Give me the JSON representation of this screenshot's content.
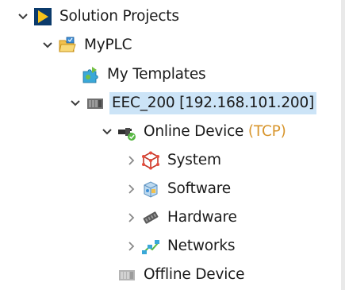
{
  "tree": {
    "solution": {
      "label": "Solution Projects",
      "expanded": true,
      "icon": "solution-logo-icon"
    },
    "plc": {
      "label": "MyPLC",
      "expanded": true,
      "icon": "project-folder-icon"
    },
    "templates": {
      "label": "My Templates",
      "icon": "templates-puzzle-icon"
    },
    "controller": {
      "label": "EEC_200 [192.168.101.200]",
      "expanded": true,
      "selected": true,
      "icon": "controller-device-icon"
    },
    "online_device": {
      "label": "Online Device",
      "protocol": "(TCP)",
      "expanded": true,
      "icon": "network-plug-icon"
    },
    "system": {
      "label": "System",
      "expanded": false,
      "icon": "system-cube-icon"
    },
    "software": {
      "label": "Software",
      "expanded": false,
      "icon": "software-box-icon"
    },
    "hardware": {
      "label": "Hardware",
      "expanded": false,
      "icon": "hardware-chip-icon"
    },
    "networks": {
      "label": "Networks",
      "expanded": false,
      "icon": "networks-icon"
    },
    "offline_device": {
      "label": "Offline Device",
      "icon": "offline-device-icon"
    }
  },
  "colors": {
    "selection": "#cce4f7",
    "protocol_text": "#d8962e",
    "chevron": "#3c3c3c",
    "chevron_collapsed": "#8a8a8a"
  }
}
